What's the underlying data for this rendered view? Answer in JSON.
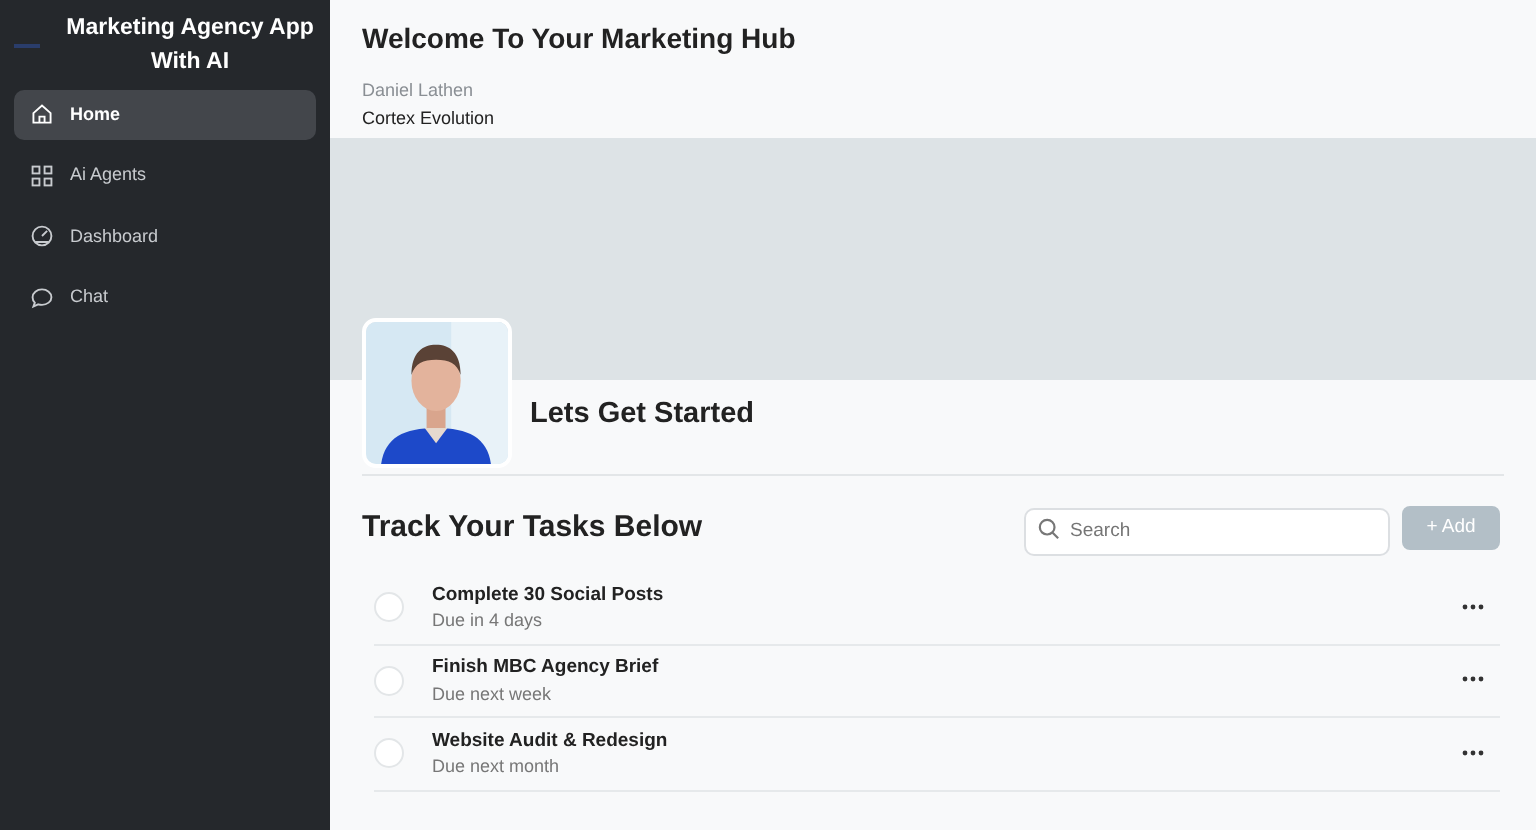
{
  "sidebar": {
    "title": "Marketing Agency App With AI",
    "items": [
      {
        "label": "Home",
        "kind": "home",
        "selected": true
      },
      {
        "label": "Ai Agents",
        "kind": "agents",
        "selected": false
      },
      {
        "label": "Dashboard",
        "kind": "dashboard",
        "selected": false
      },
      {
        "label": "Chat",
        "kind": "chat",
        "selected": false
      }
    ]
  },
  "header": {
    "title": "Welcome To Your Marketing Hub",
    "name": "Daniel Lathen",
    "company": "Cortex Evolution"
  },
  "profile": {
    "heading": "Lets Get Started"
  },
  "tasks": {
    "title": "Track Your Tasks Below",
    "search": {
      "placeholder": "Search"
    },
    "add_button": {
      "label": "+ Add",
      "disabled": true
    },
    "items": [
      {
        "title": "Complete 30 Social Posts",
        "due": "Due in 4 days",
        "checked": false
      },
      {
        "title": "Finish MBC Agency Brief",
        "due": "Due next week",
        "checked": false
      },
      {
        "title": "Website Audit & Redesign",
        "due": "Due next month",
        "checked": false
      }
    ]
  }
}
